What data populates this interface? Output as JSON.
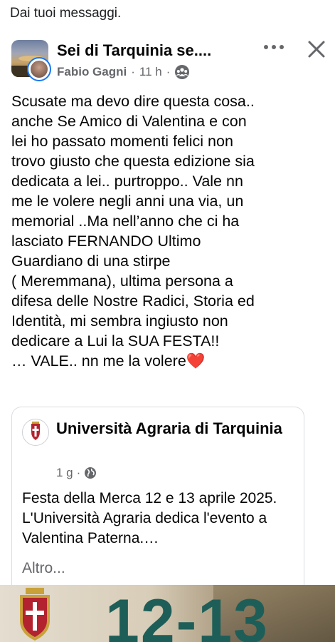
{
  "section": {
    "label": "Dai tuoi messaggi."
  },
  "post": {
    "group_name": "Sei di Tarquinia se....",
    "author": "Fabio Gagni",
    "separator": "·",
    "time": "11 h",
    "audience_icon": "group-audience-icon",
    "text": "Scusate ma devo dire questa cosa..\nanche Se Amico di Valentina e con\nlei ho passato momenti felici non\ntrovo giusto che questa edizione sia\ndedicata a lei.. purtroppo.. Vale nn\nme le volere negli anni una via, un\nmemorial ..Ma nell’anno che ci ha\nlasciato FERNANDO Ultimo\nGuardiano di una stirpe\n( Meremmana), ultima persona a\ndifesa delle Nostre Radici, Storia ed\nIdentità, mi sembra ingiusto non\ndedicare a Lui la SUA FESTA!!\n… VALE.. nn me la volere",
    "emoji": "❤️"
  },
  "shared": {
    "page_name": "Università Agraria di Tarquinia",
    "time": "1 g",
    "separator": "·",
    "audience_icon": "globe-icon",
    "text": "Festa della Merca 12 e 13 aprile 2025. L'Università Agraria dedica l'evento a Valentina Paterna.…",
    "more_label": "Altro..."
  },
  "banner": {
    "date": "12-13"
  },
  "colors": {
    "accent": "#1877f2",
    "meta": "#65676b",
    "banner_text": "#1e5e58"
  }
}
